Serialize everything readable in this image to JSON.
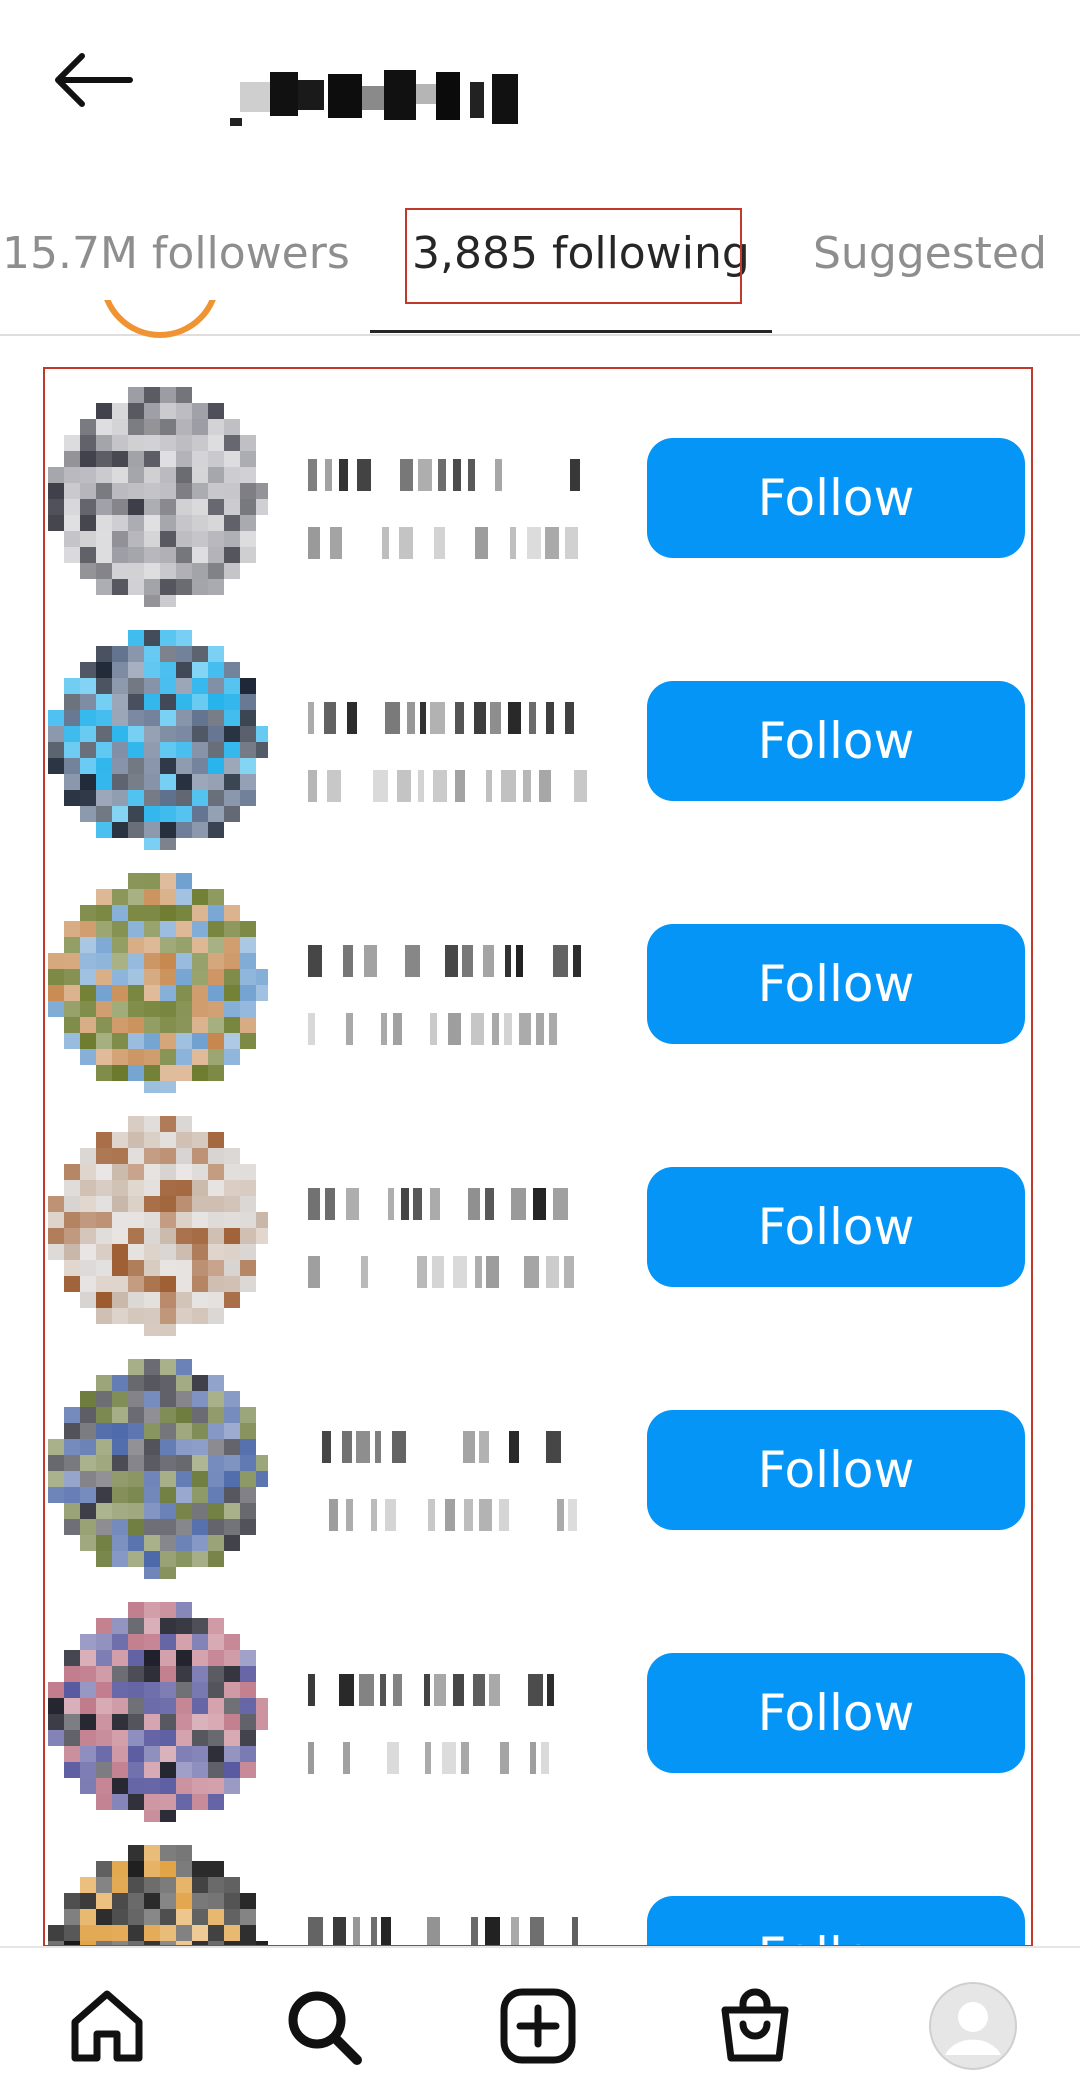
{
  "header": {
    "back_icon": "arrow-left-icon",
    "title": ""
  },
  "tabs": [
    {
      "label": "15.7M followers",
      "active": false
    },
    {
      "label": "3,885 following",
      "active": true
    },
    {
      "label": "Suggested",
      "active": false
    }
  ],
  "rows": [
    {
      "follow_label": "Follow",
      "avatar_colors": [
        "#9a9aa2",
        "#3e3e48",
        "#c8c8cc"
      ]
    },
    {
      "follow_label": "Follow",
      "avatar_colors": [
        "#27b3ec",
        "#1a2434",
        "#5d6f8c"
      ]
    },
    {
      "follow_label": "Follow",
      "avatar_colors": [
        "#6fa0d0",
        "#c6884e",
        "#6b7a2c"
      ]
    },
    {
      "follow_label": "Follow",
      "avatar_colors": [
        "#d7d3d0",
        "#9b5a2e",
        "#c8b7a8"
      ]
    },
    {
      "follow_label": "Follow",
      "avatar_colors": [
        "#3a3a44",
        "#6c7a3a",
        "#4a66a8"
      ]
    },
    {
      "follow_label": "Follow",
      "avatar_colors": [
        "#181824",
        "#c07a8a",
        "#5a5aa0"
      ]
    },
    {
      "follow_label": "Follow",
      "avatar_colors": [
        "#141414",
        "#2b2b2b",
        "#e0a040"
      ]
    }
  ],
  "bottom_nav": {
    "items": [
      "home-icon",
      "search-icon",
      "add-post-icon",
      "shop-icon",
      "profile-avatar-icon"
    ]
  },
  "colors": {
    "follow_button": "#0495f6",
    "highlight_box": "#c0392b",
    "active_tab_text": "#262626",
    "inactive_tab_text": "#8e8e8e"
  }
}
